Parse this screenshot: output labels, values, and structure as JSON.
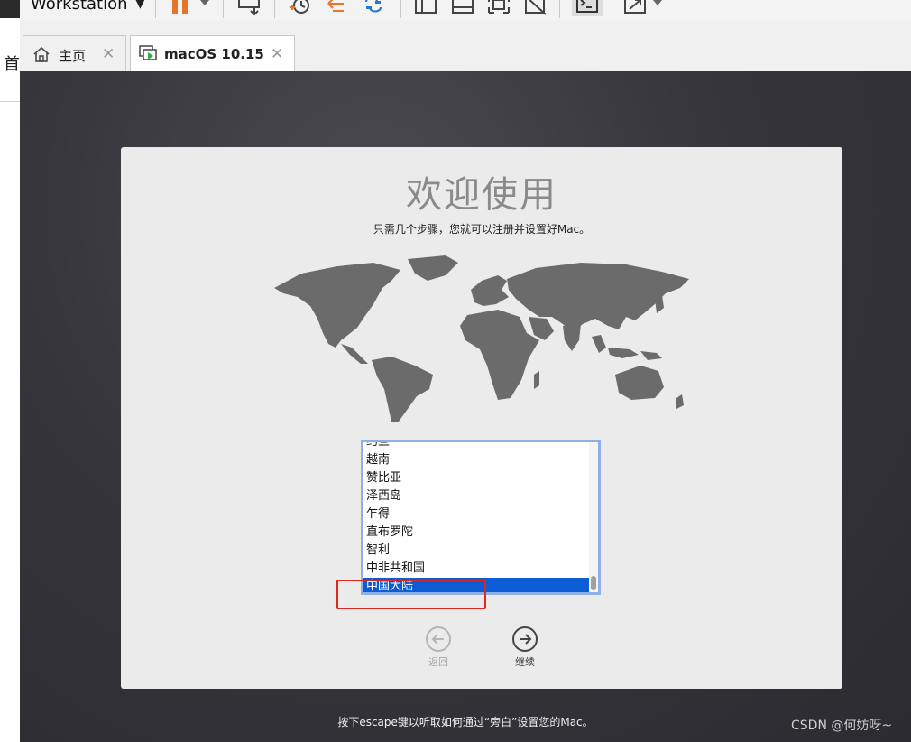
{
  "app": {
    "title": "Workstation"
  },
  "left_strip": {
    "glyph": "首"
  },
  "toolbar": {
    "icons": [
      "power-dropdown-icon",
      "send-keys-icon",
      "snapshot-take-icon",
      "snapshot-revert-icon",
      "snapshot-manager-icon",
      "view-normal-icon",
      "view-console-icon",
      "fullscreen-icon",
      "unity-icon",
      "terminal-icon",
      "stretch-icon"
    ],
    "accent": "#e8742a"
  },
  "tabs": [
    {
      "label": "主页",
      "icon": "home-icon",
      "active": false
    },
    {
      "label": "macOS 10.15",
      "icon": "vm-running-icon",
      "active": true
    }
  ],
  "setup": {
    "title": "欢迎使用",
    "subtitle": "只需几个步骤，您就可以注册并设置好Mac。",
    "countries": [
      "约旦",
      "越南",
      "赞比亚",
      "泽西岛",
      "乍得",
      "直布罗陀",
      "智利",
      "中非共和国",
      "中国大陆"
    ],
    "selected": "中国大陆",
    "back_label": "返回",
    "continue_label": "继续",
    "escape_hint": "按下escape键以听取如何通过“旁白”设置您的Mac。"
  },
  "watermark": "CSDN @何妨呀~",
  "colors": {
    "selection": "#0b5cd5",
    "highlight": "#e0271f",
    "map": "#6b6b6b"
  }
}
